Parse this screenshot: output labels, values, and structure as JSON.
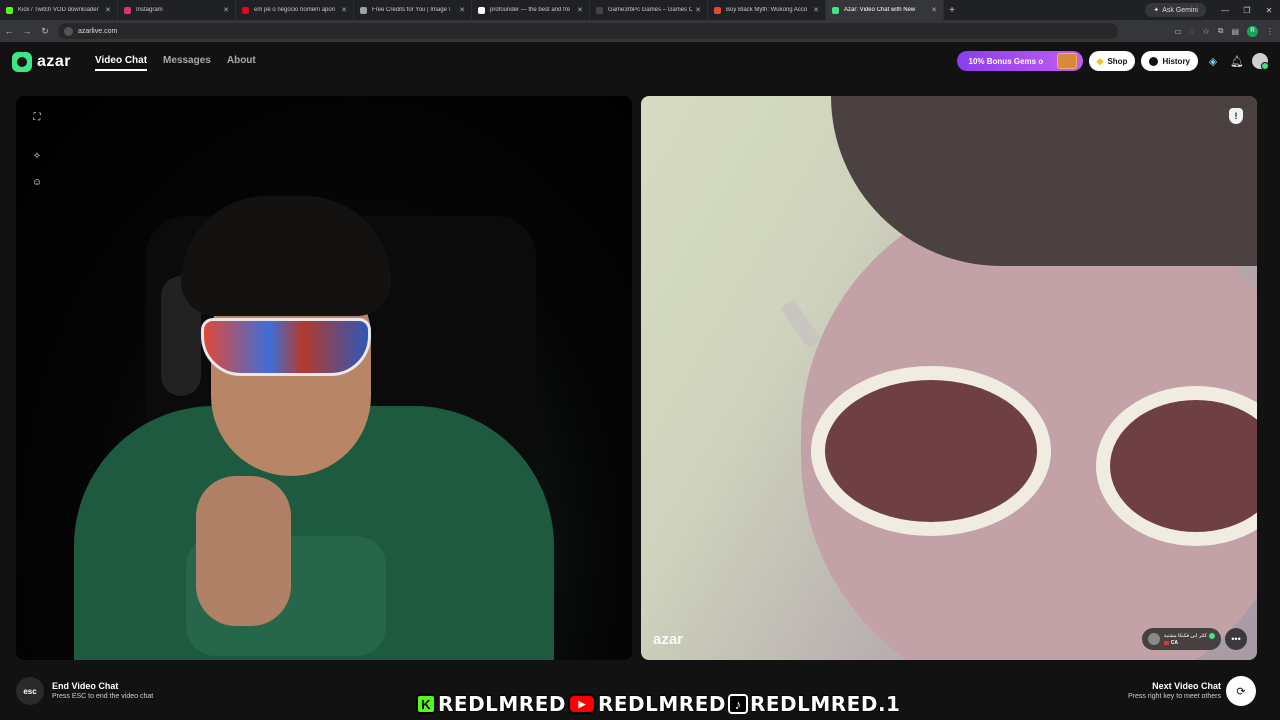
{
  "browser": {
    "tabs": [
      {
        "title": "Kick / Twitch VOD downloader",
        "color": "#53fc18",
        "active": false
      },
      {
        "title": "Instagram",
        "color": "#e1306c",
        "active": false
      },
      {
        "title": "em pé o negócio homem apon",
        "color": "#e60023",
        "active": false
      },
      {
        "title": "Free Credits for You | Image \\",
        "color": "#9aa0a6",
        "active": false
      },
      {
        "title": "profounder — the best and fre",
        "color": "#ffffff",
        "active": false
      },
      {
        "title": "Game3rbPc Games – Games Cr",
        "color": "#444444",
        "active": false
      },
      {
        "title": "Buy Black Myth: Wukong Acco",
        "color": "#e2483a",
        "active": false
      },
      {
        "title": "Azar: Video Chat with New",
        "color": "#3ee68a",
        "active": true
      }
    ],
    "ask_gemini": "Ask Gemini",
    "url": "azarlive.com",
    "profile_initial": "R"
  },
  "header": {
    "logo_text": "azar",
    "nav": [
      "Video Chat",
      "Messages",
      "About"
    ],
    "bonus_label": "10% Bonus Gems o",
    "shop_label": "Shop",
    "history_label": "History"
  },
  "video": {
    "watermark_logo": "azar",
    "watermark_user": "",
    "partner_name": "كلثر ابي فكنكا مشنية",
    "partner_country": "CA"
  },
  "footer": {
    "esc_key": "esc",
    "end_title": "End Video Chat",
    "end_sub": "Press ESC to end the video chat",
    "next_title": "Next Video Chat",
    "next_sub": "Press right key to meet others"
  },
  "overlay": {
    "kick_handle": "REDLMRED",
    "youtube_handle": "REDLMRED",
    "tiktok_handle": "REDLMRED.1"
  },
  "colors": {
    "brand": "#3ee68a",
    "background": "#121212",
    "bonus_gradient_start": "#8a3ef0",
    "bonus_gradient_end": "#c25cf2"
  }
}
